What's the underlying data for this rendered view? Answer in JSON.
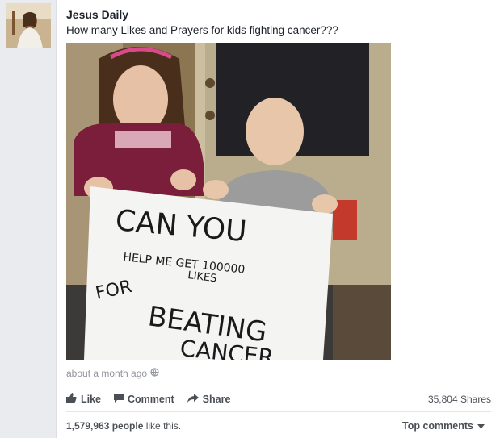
{
  "post": {
    "page_name": "Jesus Daily",
    "text": "How many Likes and Prayers for kids fighting cancer???",
    "timestamp": "about a month ago",
    "sign": {
      "line1": "CAN YOU",
      "line2": "HELP ME GET 100000",
      "line3": "LIKES",
      "line4": "FOR",
      "line5": "BEATING",
      "line6": "CANCER"
    }
  },
  "actions": {
    "like_label": "Like",
    "comment_label": "Comment",
    "share_label": "Share",
    "shares_count": "35,804 Shares"
  },
  "footer": {
    "likes_count": "1,579,963 people",
    "likes_suffix": " like this.",
    "top_comments_label": "Top comments"
  },
  "icons": [
    "globe-icon",
    "thumbs-up-icon",
    "comment-icon",
    "share-arrow-icon",
    "chevron-down-icon"
  ]
}
